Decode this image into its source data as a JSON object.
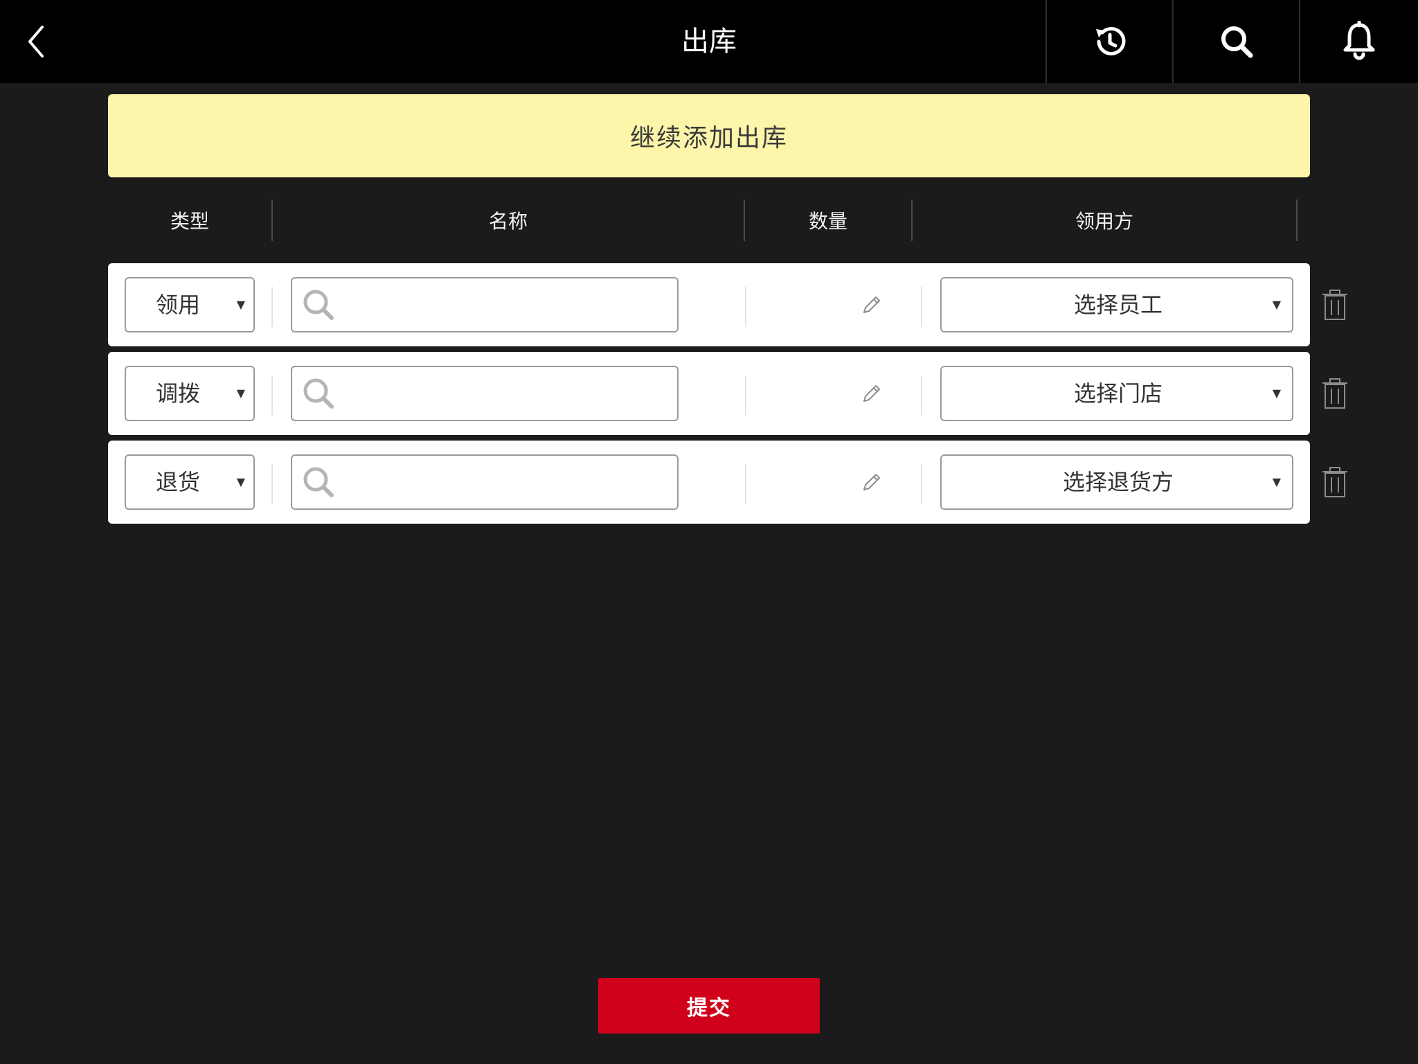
{
  "header": {
    "title": "出库",
    "back_icon": "chevron-left-icon",
    "actions": [
      "history-icon",
      "search-icon",
      "bell-icon"
    ]
  },
  "add_button": {
    "label": "继续添加出库"
  },
  "columns": {
    "type": "类型",
    "name": "名称",
    "quantity": "数量",
    "party": "领用方"
  },
  "rows": [
    {
      "type": "领用",
      "name_value": "",
      "quantity_icon": "pencil-icon",
      "party": "选择员工"
    },
    {
      "type": "调拨",
      "name_value": "",
      "quantity_icon": "pencil-icon",
      "party": "选择门店"
    },
    {
      "type": "退货",
      "name_value": "",
      "quantity_icon": "pencil-icon",
      "party": "选择退货方"
    }
  ],
  "submit": {
    "label": "提交"
  },
  "colors": {
    "background": "#1b1b1b",
    "header": "#000000",
    "add_bar": "#fdf6aa",
    "submit": "#d0021b"
  }
}
